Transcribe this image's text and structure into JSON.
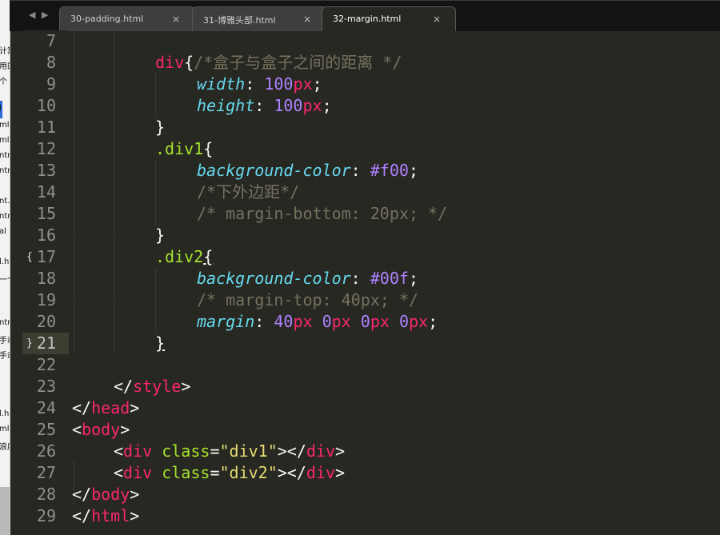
{
  "left_window": {
    "fragments": [
      "计算",
      "用的",
      "个",
      "l",
      "ml",
      "ml",
      "ntr",
      "ntr",
      "nt.",
      "ntr",
      "al",
      "l.ht",
      "一个",
      "ntr",
      "手动",
      "手动",
      "l.h",
      "ml",
      "浪度"
    ]
  },
  "tabs": [
    {
      "label": "30-padding.html",
      "close": "×",
      "active": false
    },
    {
      "label": "31-博雅头部.html",
      "close": "×",
      "active": false
    },
    {
      "label": "32-margin.html",
      "close": "×",
      "active": true
    }
  ],
  "nav": {
    "back": "◀",
    "forward": "▶"
  },
  "editor": {
    "current_line": 21,
    "fold_markers": {
      "17": "{",
      "21": "}"
    },
    "lines": [
      {
        "n": "7"
      },
      {
        "n": "8"
      },
      {
        "n": "9"
      },
      {
        "n": "10"
      },
      {
        "n": "11"
      },
      {
        "n": "12"
      },
      {
        "n": "13"
      },
      {
        "n": "14"
      },
      {
        "n": "15"
      },
      {
        "n": "16"
      },
      {
        "n": "17"
      },
      {
        "n": "18"
      },
      {
        "n": "19"
      },
      {
        "n": "20"
      },
      {
        "n": "21"
      },
      {
        "n": "22"
      },
      {
        "n": "23"
      },
      {
        "n": "24"
      },
      {
        "n": "25"
      },
      {
        "n": "26"
      },
      {
        "n": "27"
      },
      {
        "n": "28"
      },
      {
        "n": "29"
      }
    ],
    "code": {
      "l7_comment": "/*盒子与盒子之间的距离 */",
      "l8_sel": "div",
      "l8_brace": "{",
      "l9_prop": "width",
      "l9_colon": ": ",
      "l9_num": "100",
      "l9_unit": "px",
      "l9_semi": ";",
      "l10_prop": "height",
      "l10_colon": ": ",
      "l10_num": "100",
      "l10_unit": "px",
      "l10_semi": ";",
      "l11_brace": "}",
      "l12_sel": ".div1",
      "l12_brace": "{",
      "l13_prop": "background-color",
      "l13_colon": ": ",
      "l13_val": "#f00",
      "l13_semi": ";",
      "l14_comment": "/*下外边距*/",
      "l15_comment": "/* margin-bottom: 20px; */",
      "l16_brace": "}",
      "l17_sel": ".div2",
      "l17_brace": "{",
      "l18_prop": "background-color",
      "l18_colon": ": ",
      "l18_val": "#00f",
      "l18_semi": ";",
      "l19_comment": "/* margin-top: 40px; */",
      "l20_prop": "margin",
      "l20_colon": ": ",
      "l20_n1": "40",
      "l20_u1": "px",
      "l20_n2": "0",
      "l20_u2": "px",
      "l20_n3": "0",
      "l20_u3": "px",
      "l20_n4": "0",
      "l20_u4": "px",
      "l20_semi": ";",
      "l21_brace": "}",
      "l23_open": "</",
      "l23_tag": "style",
      "l23_close": ">",
      "l24_open": "</",
      "l24_tag": "head",
      "l24_close": ">",
      "l25_open": "<",
      "l25_tag": "body",
      "l25_close": ">",
      "l26_open": "<",
      "l26_tag": "div",
      "l26_attr": "class",
      "l26_eq": "=",
      "l26_str": "\"div1\"",
      "l26_mid": "></",
      "l26_tag2": "div",
      "l26_close": ">",
      "l27_open": "<",
      "l27_tag": "div",
      "l27_attr": "class",
      "l27_eq": "=",
      "l27_str": "\"div2\"",
      "l27_mid": "></",
      "l27_tag2": "div",
      "l27_close": ">",
      "l28_open": "</",
      "l28_tag": "body",
      "l28_close": ">",
      "l29_open": "</",
      "l29_tag": "html",
      "l29_close": ">"
    }
  },
  "colors": {
    "background": "#272822",
    "comment": "#75715e",
    "tag": "#f92672",
    "property": "#66d9ef",
    "number": "#ae81ff",
    "class_selector": "#a6e22e",
    "string": "#e6db74"
  }
}
